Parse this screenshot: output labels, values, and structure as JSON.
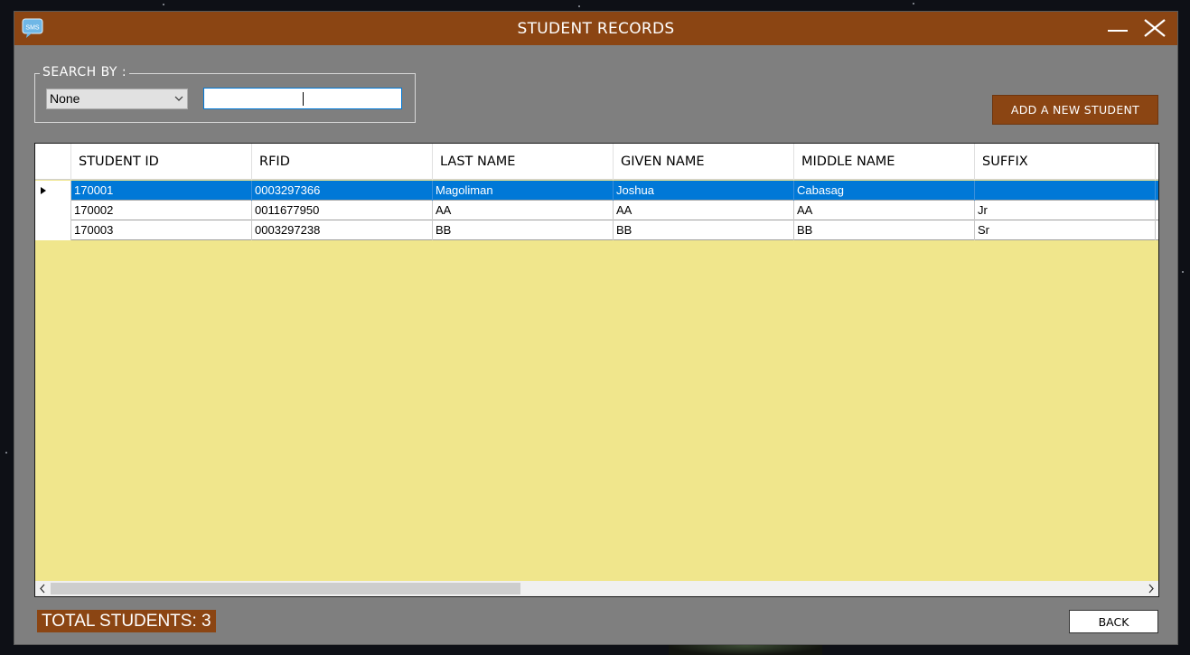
{
  "window": {
    "title": "STUDENT RECORDS",
    "app_icon_label": "SMS",
    "accent_color": "#8b4513",
    "grid_background_color": "#f0e68c",
    "selection_color": "#0078d7"
  },
  "search": {
    "group_label": "SEARCH BY :",
    "field_selected": "None",
    "query_value": "",
    "field_icon": "chevron-down-icon"
  },
  "actions": {
    "add_student_label": "ADD A NEW STUDENT",
    "back_label": "BACK"
  },
  "table": {
    "columns": [
      "STUDENT ID",
      "RFID",
      "LAST NAME",
      "GIVEN NAME",
      "MIDDLE NAME",
      "SUFFIX"
    ],
    "rows": [
      {
        "student_id": "170001",
        "rfid": "0003297366",
        "last_name": "Magoliman",
        "given_name": "Joshua",
        "middle_name": "Cabasag",
        "suffix": ""
      },
      {
        "student_id": "170002",
        "rfid": "0011677950",
        "last_name": "AA",
        "given_name": "AA",
        "middle_name": "AA",
        "suffix": "Jr"
      },
      {
        "student_id": "170003",
        "rfid": "0003297238",
        "last_name": "BB",
        "given_name": "BB",
        "middle_name": "BB",
        "suffix": "Sr"
      }
    ],
    "selected_row": 0
  },
  "footer": {
    "total_label": "TOTAL STUDENTS: 3"
  }
}
